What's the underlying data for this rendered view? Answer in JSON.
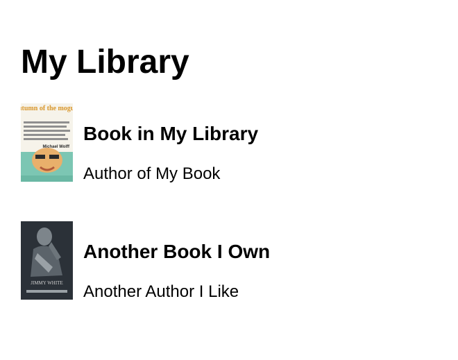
{
  "page": {
    "title": "My Library"
  },
  "books": [
    {
      "title": "Book in My Library",
      "author": "Author of My Book",
      "cover": {
        "icon": "book-cover-image",
        "cover_title": "autumn of the moguls",
        "cover_subtitle": "My Misadventures with the Titans, Poseurs, and Money Guys who Mastered and Messed Up Big Media",
        "cover_author": "Michael Wolff",
        "colors": {
          "title": "#d9962a",
          "text": "#555555",
          "bottom": "#7cc6b3",
          "skin": "#e9b06b"
        }
      }
    },
    {
      "title": "Another Book I Own",
      "author": "Another Author I Like",
      "cover": {
        "icon": "book-cover-image",
        "cover_author": "JIMMY WHITE",
        "colors": {
          "background": "#2b3138",
          "figure": "#9aa1a6",
          "text": "#cfcfcf"
        }
      }
    }
  ]
}
